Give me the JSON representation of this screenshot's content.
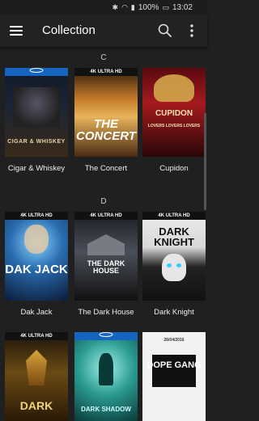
{
  "status_bar": {
    "battery": "100%",
    "time": "13:02"
  },
  "app_bar": {
    "title": "Collection"
  },
  "sections": [
    {
      "letter": "C",
      "items": [
        {
          "label": "Cigar & Whiskey",
          "band": "",
          "poster_title": "CIGAR & WHISKEY"
        },
        {
          "label": "The Concert",
          "band": "4K ULTRA HD",
          "poster_title": "THE CONCERT"
        },
        {
          "label": "Cupidon",
          "band": "",
          "poster_title": "CUPIDON"
        }
      ]
    },
    {
      "letter": "D",
      "items": [
        {
          "label": "Dak Jack",
          "band": "4K ULTRA HD",
          "poster_title": "DAK JACK"
        },
        {
          "label": "The Dark House",
          "band": "4K ULTRA HD",
          "poster_title": "THE DARK HOUSE"
        },
        {
          "label": "Dark Knight",
          "band": "4K ULTRA HD",
          "poster_title": "DARK KNIGHT"
        }
      ]
    },
    {
      "letter": "",
      "items": [
        {
          "label": "",
          "band": "4K ULTRA HD",
          "poster_title": "DARK"
        },
        {
          "label": "",
          "band": "",
          "poster_title": "DARK SHADOW"
        },
        {
          "label": "",
          "band": "",
          "poster_title": "DOPE GANG"
        }
      ]
    }
  ],
  "poster_sub": {
    "cupidon_small": "LOVERS LOVERS LOVERS",
    "dope_date": "26/04/2016"
  },
  "colors": {
    "background": "#202020",
    "app_bar": "#222222",
    "bluray_band": "#1565c0"
  }
}
